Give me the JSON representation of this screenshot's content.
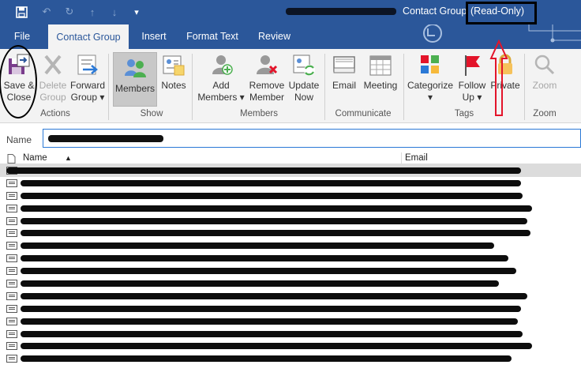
{
  "window": {
    "title": "Contact Group",
    "read_only": "(Read-Only)"
  },
  "tabs": [
    {
      "label": "File"
    },
    {
      "label": "Contact Group"
    },
    {
      "label": "Insert"
    },
    {
      "label": "Format Text"
    },
    {
      "label": "Review"
    }
  ],
  "ribbon": {
    "actions": {
      "group_label": "Actions",
      "save_close": "Save &\nClose",
      "delete_group": "Delete\nGroup",
      "forward_group": "Forward\nGroup ▾"
    },
    "show": {
      "group_label": "Show",
      "members": "Members",
      "notes": "Notes"
    },
    "members": {
      "group_label": "Members",
      "add_members": "Add\nMembers ▾",
      "remove_member": "Remove\nMember",
      "update_now": "Update\nNow"
    },
    "communicate": {
      "group_label": "Communicate",
      "email": "Email",
      "meeting": "Meeting"
    },
    "tags": {
      "group_label": "Tags",
      "categorize": "Categorize\n▾",
      "follow_up": "Follow\nUp ▾",
      "private": "Private"
    },
    "zoom": {
      "group_label": "Zoom",
      "zoom": "Zoom"
    }
  },
  "name_field": {
    "label": "Name"
  },
  "table": {
    "columns": {
      "name": "Name",
      "email": "Email"
    },
    "row_count": 16
  },
  "colors": {
    "brand": "#2b579a",
    "ribbon_bg": "#f3f3f3",
    "annotation_red": "#e3142a"
  }
}
